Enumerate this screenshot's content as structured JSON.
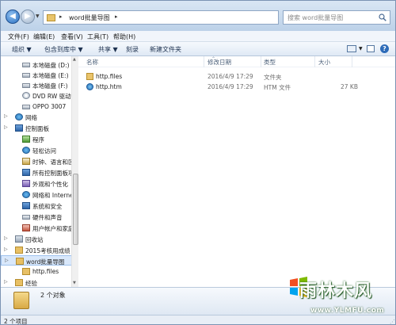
{
  "address": {
    "path": "word批量导图",
    "separator": "▸"
  },
  "search": {
    "placeholder": "搜索 word批量导图"
  },
  "menu": [
    "文件(F)",
    "编辑(E)",
    "查看(V)",
    "工具(T)",
    "帮助(H)"
  ],
  "toolbar": {
    "organize": "组织 ▼",
    "include_library": "包含到库中 ▼",
    "share": "共享 ▼",
    "burn": "刻录",
    "new_folder": "新建文件夹"
  },
  "nav": [
    {
      "label": "本地磁盘 (D:)",
      "icon": "drive-icon",
      "indent": 2
    },
    {
      "label": "本地磁盘 (E:)",
      "icon": "drive-icon",
      "indent": 2
    },
    {
      "label": "本地磁盘 (F:)",
      "icon": "drive-icon",
      "indent": 2
    },
    {
      "label": "DVD RW 驱动",
      "icon": "dvd-drive-icon",
      "indent": 2
    },
    {
      "label": "OPPO 3007",
      "icon": "device-icon",
      "indent": 2
    },
    {
      "label": "网络",
      "icon": "network-icon",
      "indent": 1
    },
    {
      "label": "控制面板",
      "icon": "control-panel-icon",
      "indent": 1
    },
    {
      "label": "程序",
      "icon": "programs-icon",
      "indent": 2
    },
    {
      "label": "轻松访问",
      "icon": "ease-of-access-icon",
      "indent": 2
    },
    {
      "label": "时钟、语言和区",
      "icon": "clock-icon",
      "indent": 2
    },
    {
      "label": "所有控制面板项",
      "icon": "all-items-icon",
      "indent": 2
    },
    {
      "label": "外观和个性化",
      "icon": "appearance-icon",
      "indent": 2
    },
    {
      "label": "网络和 Internet",
      "icon": "network-internet-icon",
      "indent": 2
    },
    {
      "label": "系统和安全",
      "icon": "security-icon",
      "indent": 2
    },
    {
      "label": "硬件和声音",
      "icon": "hardware-icon",
      "indent": 2
    },
    {
      "label": "用户帐户和家庭",
      "icon": "user-accounts-icon",
      "indent": 2
    },
    {
      "label": "回收站",
      "icon": "recycle-bin-icon",
      "indent": 1
    },
    {
      "label": "2015考核用成绩",
      "icon": "folder-icon",
      "indent": 1
    },
    {
      "label": "word批量导图",
      "icon": "folder-icon",
      "indent": 1,
      "selected": true
    },
    {
      "label": "http.files",
      "icon": "folder-icon",
      "indent": 2
    },
    {
      "label": "经验",
      "icon": "folder-icon",
      "indent": 1
    },
    {
      "label": "word导图",
      "icon": "folder-icon",
      "indent": 2
    }
  ],
  "columns": {
    "name": "名称",
    "date": "修改日期",
    "type": "类型",
    "size": "大小"
  },
  "files": [
    {
      "name": "http.files",
      "date": "2016/4/9 17:29",
      "type": "文件夹",
      "size": "",
      "icon": "folder-icon"
    },
    {
      "name": "http.htm",
      "date": "2016/4/9 17:29",
      "type": "HTM 文件",
      "size": "27 KB",
      "icon": "htm-file-icon"
    }
  ],
  "details": {
    "count": "2 个对象"
  },
  "status": {
    "text": "2 个项目"
  },
  "watermark": {
    "brand": "雨林木风",
    "url": "www.YLMFU.com"
  }
}
